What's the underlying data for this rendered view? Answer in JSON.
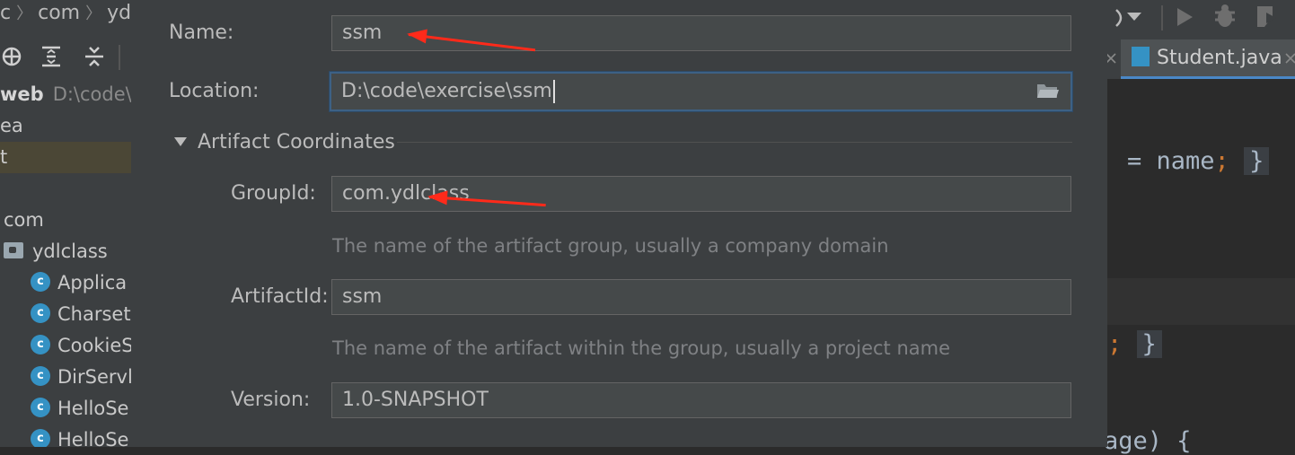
{
  "breadcrumb": {
    "items": [
      "c",
      "com",
      "ydl"
    ]
  },
  "project_tree": {
    "root_label": "web",
    "root_path": "D:\\code\\",
    "rows": [
      {
        "label": "ea"
      },
      {
        "label": "t"
      },
      {
        "label": ""
      },
      {
        "label": "com"
      },
      {
        "label": "ydlclass"
      },
      {
        "label": "Applica"
      },
      {
        "label": "Charset"
      },
      {
        "label": "CookieS"
      },
      {
        "label": "DirServl"
      },
      {
        "label": "HelloSe"
      },
      {
        "label": "HelloSe"
      }
    ],
    "class_icon_letter": "c"
  },
  "editor": {
    "tab_label": "Student.java",
    "line1_text": "= name",
    "line1_semi": ";",
    "line1_brace": "}",
    "line2_semi": ";",
    "line2_brace": "}",
    "line3_text": "age) {"
  },
  "dialog": {
    "name_label": "Name:",
    "name_value": "ssm",
    "location_label": "Location:",
    "location_value": "D:\\code\\exercise\\ssm",
    "section_title": "Artifact Coordinates",
    "groupid_label": "GroupId:",
    "groupid_value": "com.ydlclass",
    "groupid_hint": "The name of the artifact group, usually a company domain",
    "artifactid_label": "ArtifactId:",
    "artifactid_value": "ssm",
    "artifactid_hint": "The name of the artifact within the group, usually a project name",
    "version_label": "Version:",
    "version_value": "1.0-SNAPSHOT"
  },
  "colors": {
    "dialog_bg": "#3c3f41",
    "field_bg": "#45494a",
    "focus_border": "#3d6185",
    "annotation_arrow": "#ff2a1a",
    "accent_tab": "#4a88c7"
  }
}
